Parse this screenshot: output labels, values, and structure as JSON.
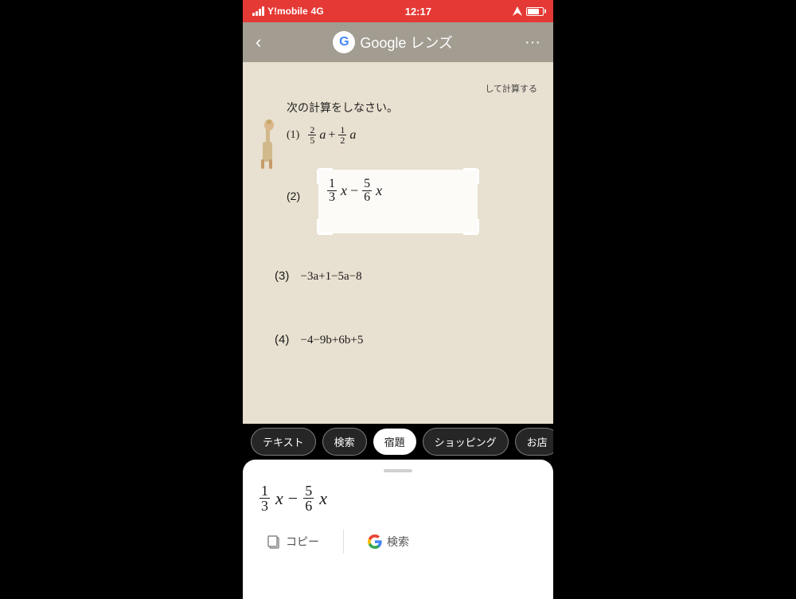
{
  "status_bar": {
    "carrier": "Y!mobile",
    "network": "4G",
    "time": "12:17",
    "battery_pct": 75
  },
  "header": {
    "title": "Google レンズ",
    "back_label": "‹",
    "more_label": "···"
  },
  "camera": {
    "top_text": "して計算する",
    "instruction": "次の計算をしなさい。",
    "problem1_num": "(1)",
    "problem1_expr": "²⁄₅a + ¹⁄₂a",
    "problem2_num": "(2)",
    "problem3_num": "(3)",
    "problem3_expr": "−3a+1−5a−8",
    "problem4_num": "(4)",
    "problem4_expr": "−4−9b+6b+5"
  },
  "tabs": [
    {
      "id": "text",
      "label": "テキスト",
      "active": false
    },
    {
      "id": "search",
      "label": "検索",
      "active": false
    },
    {
      "id": "homework",
      "label": "宿題",
      "active": true
    },
    {
      "id": "shopping",
      "label": "ショッピング",
      "active": false
    },
    {
      "id": "store",
      "label": "お店",
      "active": false
    }
  ],
  "result_panel": {
    "handle": "",
    "math_display": "1/3 x − 5/6 x",
    "copy_label": "コピー",
    "search_label": "検索"
  }
}
